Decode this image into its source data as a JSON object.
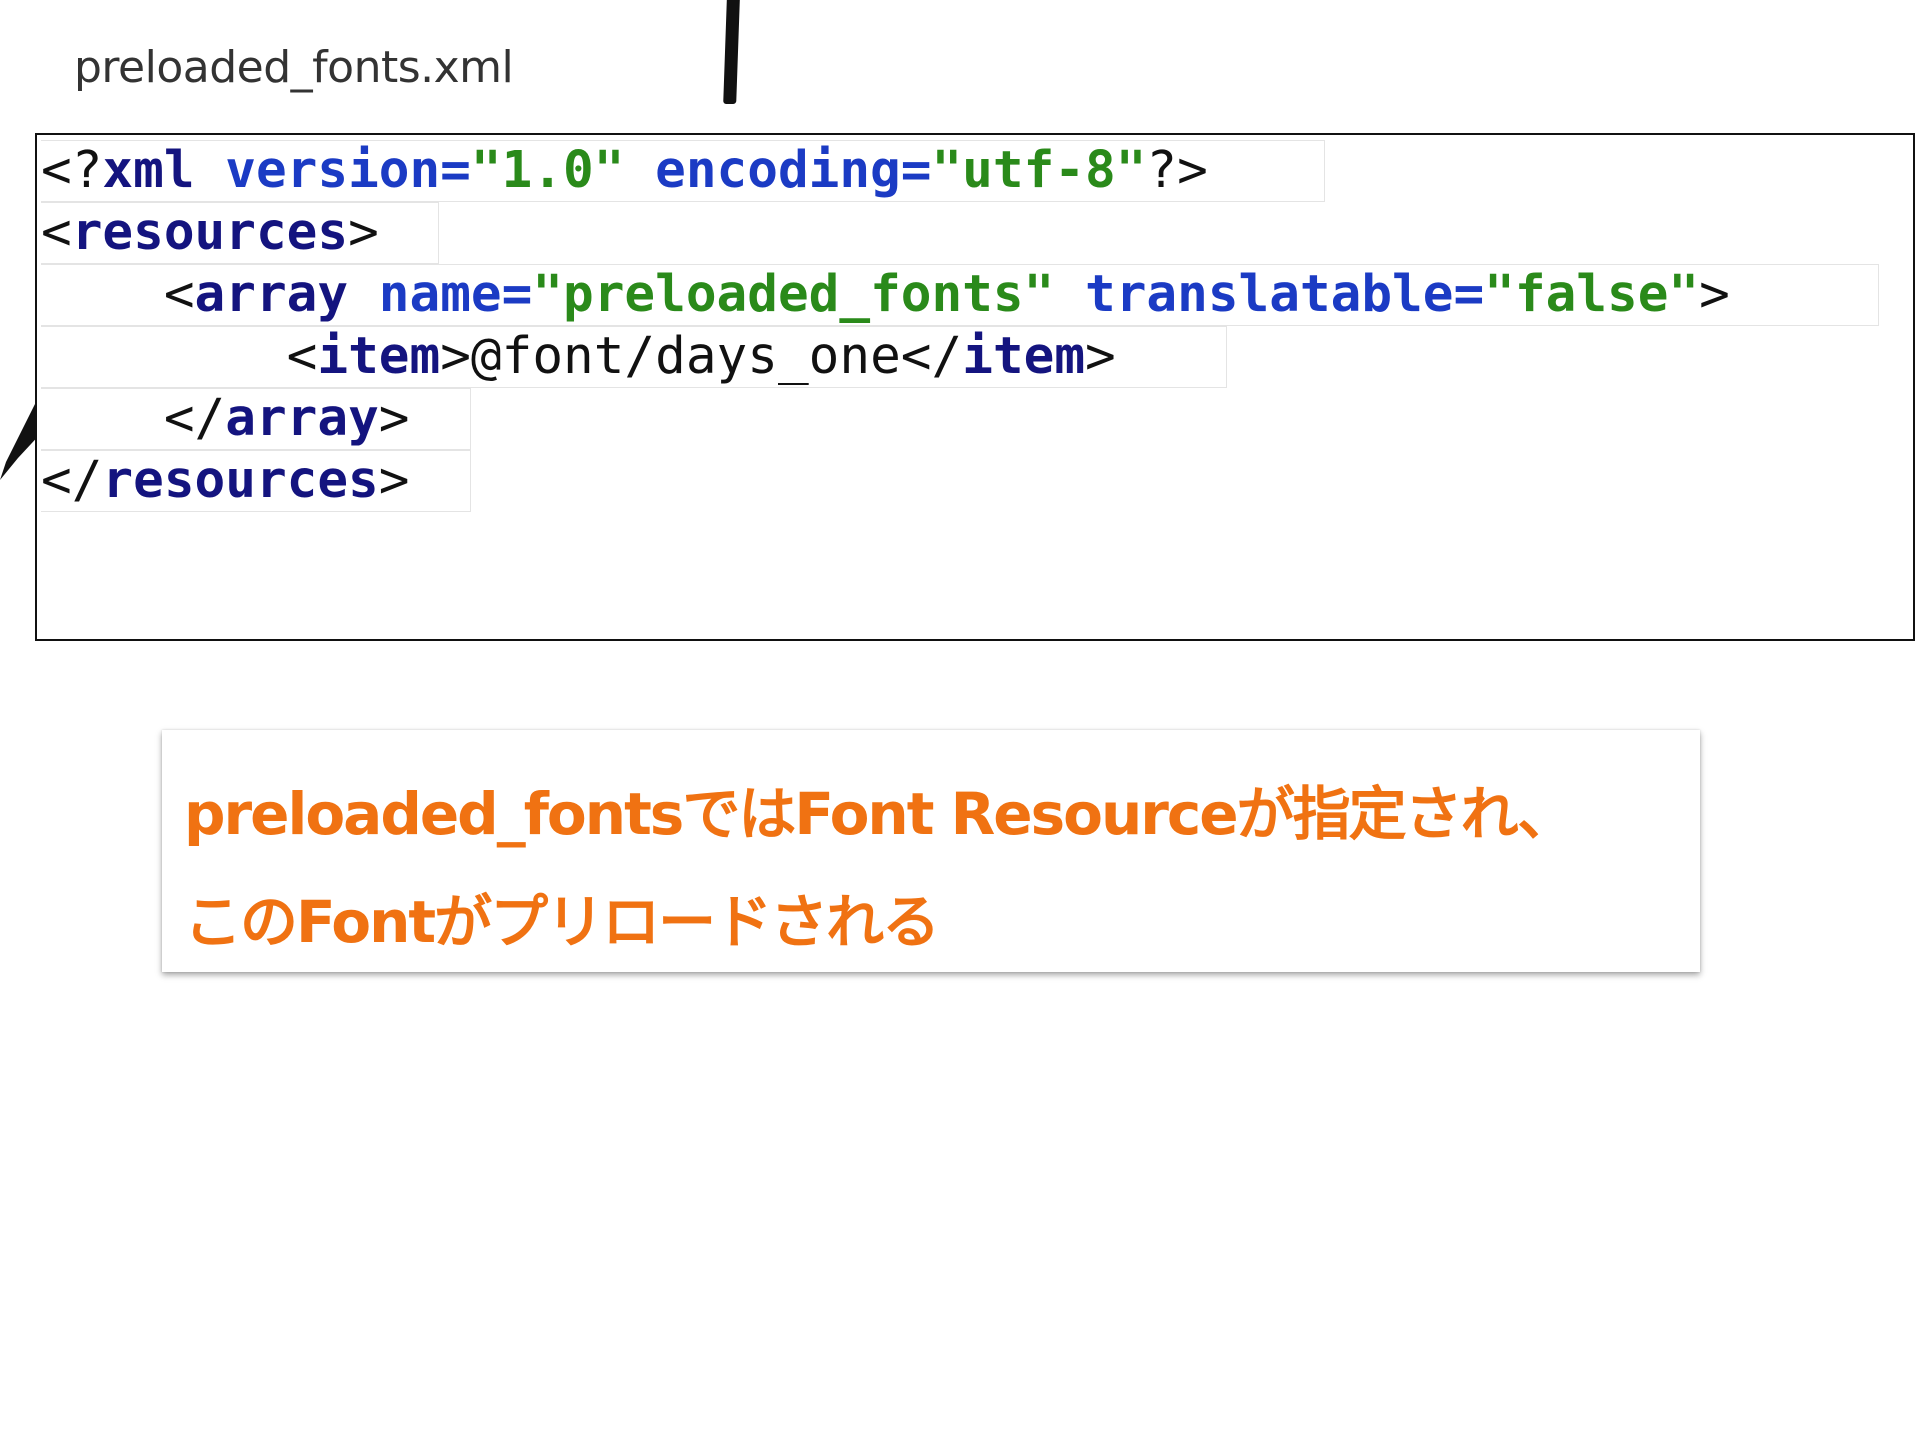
{
  "file": {
    "name": "preloaded_fonts.xml"
  },
  "code": {
    "line1": {
      "open": "<?",
      "tag": "xml",
      "attr1": " version=",
      "val1": "\"1.0\"",
      "attr2": " encoding=",
      "val2": "\"utf-8\"",
      "close": "?>"
    },
    "line2": {
      "open": "<",
      "tag": "resources",
      "close": ">"
    },
    "line3": {
      "indent": "    ",
      "open": "<",
      "tag": "array",
      "attr1": " name=",
      "val1": "\"preloaded_fonts\"",
      "attr2": " translatable=",
      "val2": "\"false\"",
      "close": ">"
    },
    "line4": {
      "indent": "        ",
      "open": "<",
      "tag": "item",
      "mid": ">",
      "text": "@font/days_one",
      "open2": "</",
      "tag2": "item",
      "close": ">"
    },
    "line5": {
      "indent": "    ",
      "open": "</",
      "tag": "array",
      "close": ">"
    },
    "line6": {
      "open": "</",
      "tag": "resources",
      "close": ">"
    }
  },
  "note": {
    "line1": "preloaded_fontsではFont Resourceが指定され、",
    "line2": "このFontがプリロードされる",
    "color": "#f07212"
  }
}
